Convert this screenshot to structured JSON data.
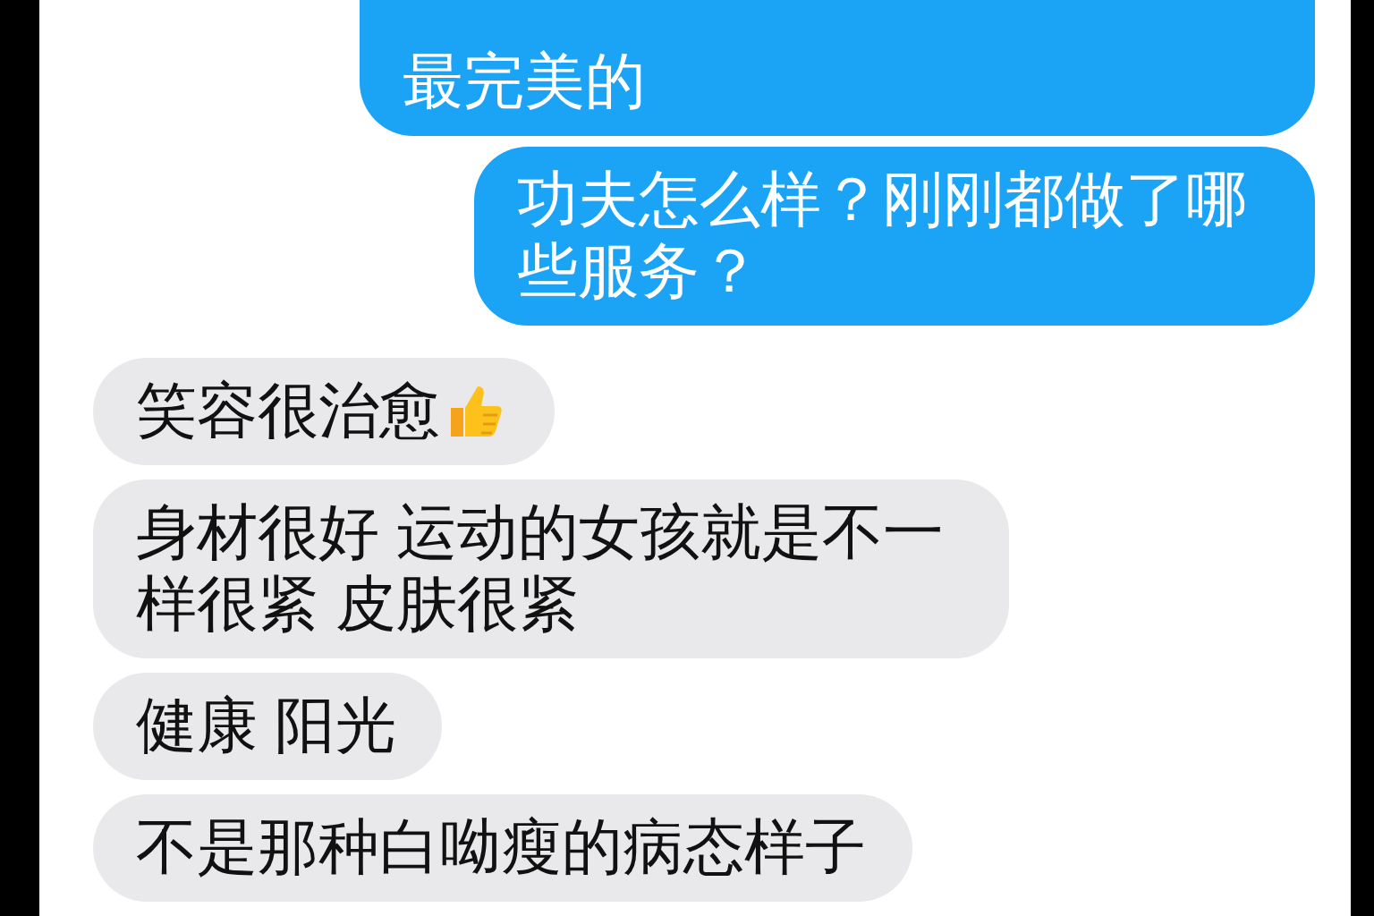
{
  "messages": [
    {
      "kind": "sent",
      "text": "最完美的"
    },
    {
      "kind": "sent",
      "text": "功夫怎么样？刚刚都做了哪些服务？"
    },
    {
      "kind": "received",
      "text": "笑容很治愈",
      "thumbs_up": true
    },
    {
      "kind": "received",
      "text": "身材很好 运动的女孩就是不一样很紧 皮肤很紧"
    },
    {
      "kind": "received",
      "text": "健康 阳光"
    },
    {
      "kind": "received",
      "text": "不是那种白呦瘦的病态样子"
    }
  ]
}
